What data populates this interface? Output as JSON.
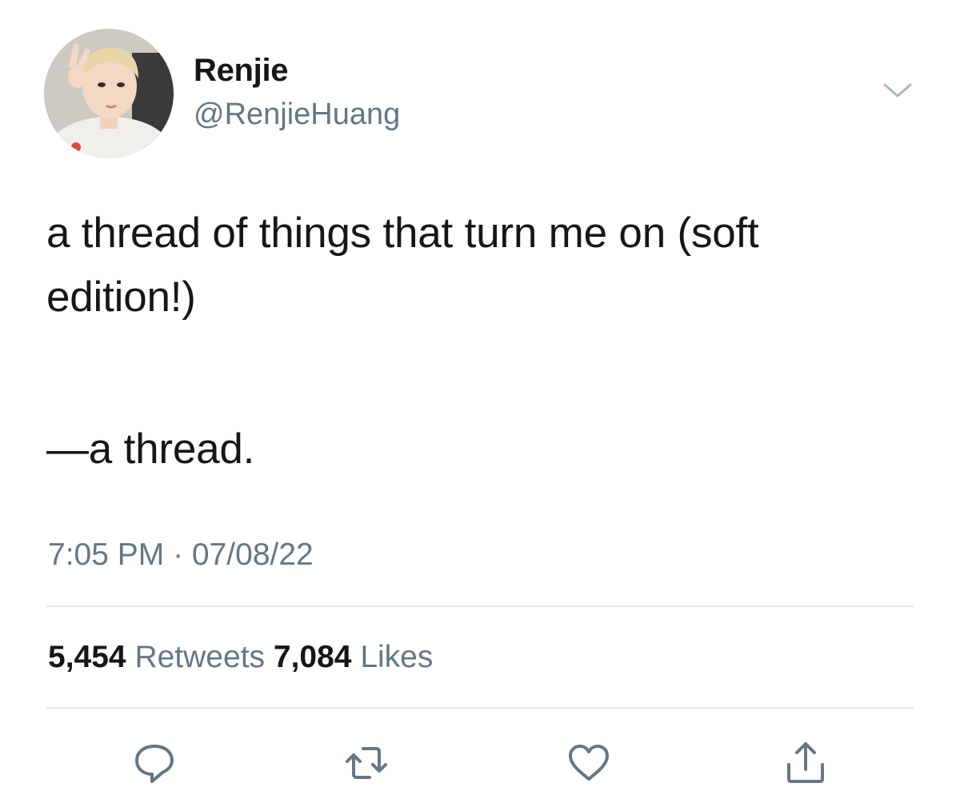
{
  "author": {
    "display_name": "Renjie",
    "handle": "@RenjieHuang"
  },
  "tweet": {
    "line1": "a thread of things that turn me on (soft",
    "line2": "edition!)",
    "line3": "—a thread.",
    "time": "7:05 PM",
    "separator": " · ",
    "date": "07/08/22"
  },
  "stats": {
    "retweets_count": "5,454",
    "retweets_label": "Retweets",
    "likes_count": "7,084",
    "likes_label": "Likes"
  },
  "actions": {
    "reply_icon": "speech-bubble-icon",
    "retweet_icon": "retweet-arrows-icon",
    "like_icon": "heart-icon",
    "share_icon": "share-upload-icon"
  },
  "colors": {
    "text": "#14171a",
    "secondary": "#657786",
    "divider": "#e1e8ed"
  }
}
